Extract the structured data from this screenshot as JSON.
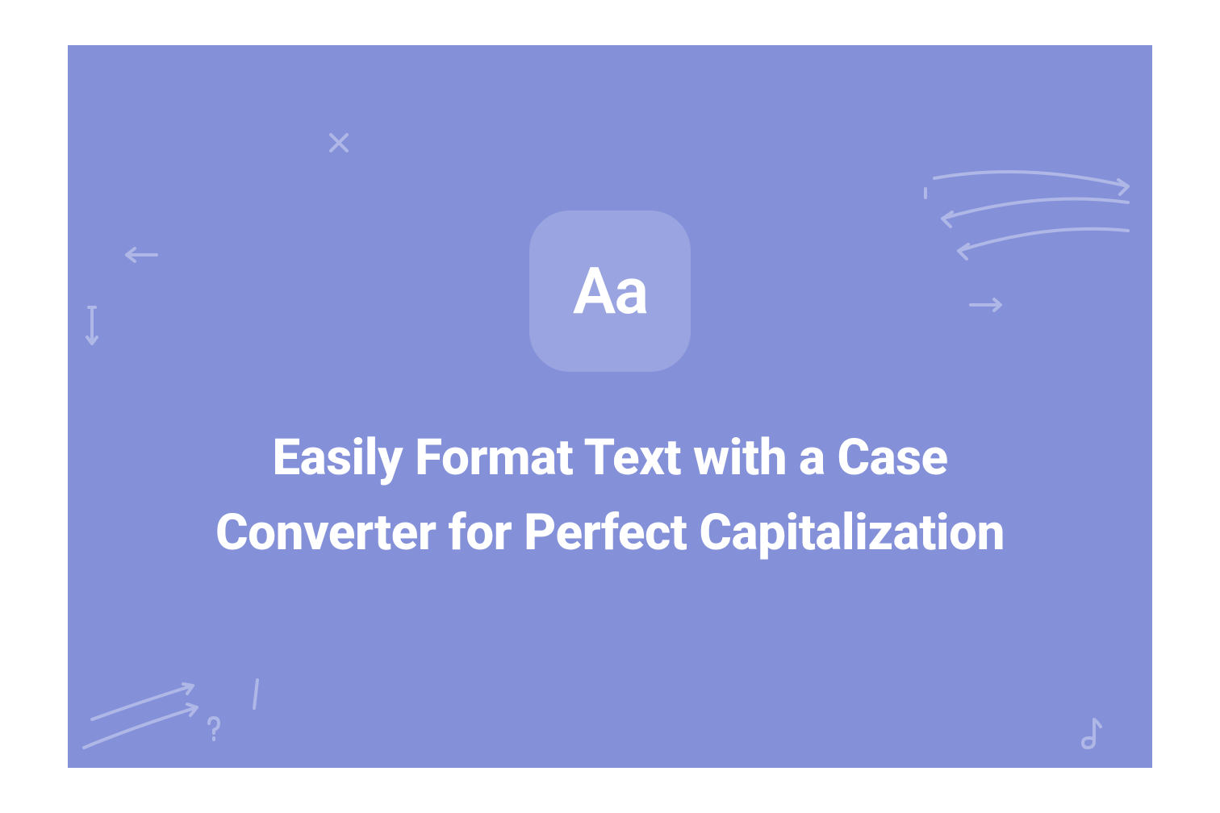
{
  "hero": {
    "icon_text": "Aa",
    "headline": "Easily Format Text with a Case Converter for Perfect Capitalization"
  }
}
